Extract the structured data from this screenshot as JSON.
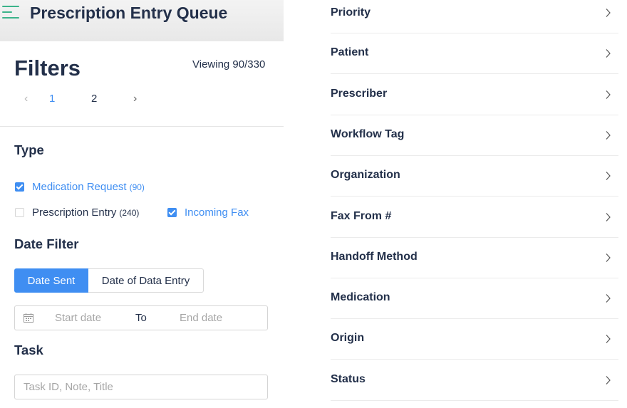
{
  "header": {
    "title": "Prescription Entry Queue",
    "menu_icon": "menu-icon"
  },
  "filters": {
    "title": "Filters",
    "viewing": "Viewing 90/330",
    "pagination": {
      "pages": [
        "1",
        "2"
      ],
      "current": "1"
    }
  },
  "type_section": {
    "title": "Type",
    "options": [
      {
        "label": "Medication Request",
        "count": "(90)",
        "checked": true
      },
      {
        "label": "Prescription Entry",
        "count": "(240)",
        "checked": false
      },
      {
        "label": "Incoming Fax",
        "count": "",
        "checked": true
      }
    ]
  },
  "date_filter": {
    "title": "Date Filter",
    "tabs": [
      "Date Sent",
      "Date of Data Entry"
    ],
    "active_tab": "Date Sent",
    "start_placeholder": "Start date",
    "separator": "To",
    "end_placeholder": "End date"
  },
  "task": {
    "title": "Task",
    "placeholder": "Task ID, Note, Title",
    "value": ""
  },
  "right_filters": [
    "Priority",
    "Patient",
    "Prescriber",
    "Workflow Tag",
    "Organization",
    "Fax From #",
    "Handoff Method",
    "Medication",
    "Origin",
    "Status"
  ],
  "colors": {
    "accent": "#3f8ef2",
    "menu_icon": "#3bb38a",
    "heading": "#23304a"
  }
}
